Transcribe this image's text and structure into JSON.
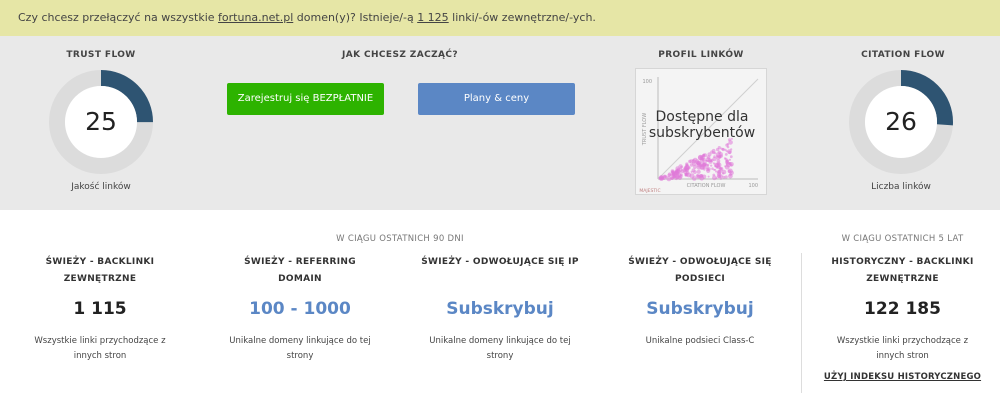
{
  "banner": {
    "text_before": "Czy chcesz przełączyć na wszystkie ",
    "domain_link": "fortuna.net.pl",
    "text_middle": " domen(y)? Istnieje/-ą ",
    "count_link": "1 125",
    "text_after": " linki/-ów zewnętrzne/-ych."
  },
  "trust_flow": {
    "title": "TRUST FLOW",
    "value": "25",
    "fraction": 0.25,
    "caption": "Jakość linków"
  },
  "start": {
    "title": "JAK CHCESZ ZACZĄĆ?",
    "register_label": "Zarejestruj się BEZPŁATNIE",
    "plans_label": "Plany & ceny"
  },
  "profile": {
    "title": "PROFIL LINKÓW",
    "overlay_line1": "Dostępne dla",
    "overlay_line2": "subskrybentów",
    "axis_x": "CITATION FLOW",
    "axis_y": "TRUST FLOW",
    "tick_max_x": "100",
    "tick_max_y": "100",
    "logo": "MAJESTIC"
  },
  "citation_flow": {
    "title": "CITATION FLOW",
    "value": "26",
    "fraction": 0.26,
    "caption": "Liczba linków"
  },
  "recent": {
    "label": "W CIĄGU OSTATNICH 90 DNI",
    "stats": [
      {
        "title_line1": "ŚWIEŻY - BACKLINKI",
        "title_line2": "ZEWNĘTRZNE",
        "value": "1 115",
        "desc_line1": "Wszystkie linki przychodzące z",
        "desc_line2": "innych stron"
      },
      {
        "title_line1": "ŚWIEŻY - REFERRING",
        "title_line2": "DOMAIN",
        "value": "100 - 1000",
        "desc_line1": "Unikalne domeny linkujące do tej",
        "desc_line2": "strony"
      },
      {
        "title_line1": "ŚWIEŻY - ODWOŁUJĄCE SIĘ IP",
        "title_line2": "",
        "value": "Subskrybuj",
        "desc_line1": "Unikalne domeny linkujące do tej",
        "desc_line2": "strony"
      },
      {
        "title_line1": "ŚWIEŻY - ODWOŁUJĄCE SIĘ",
        "title_line2": "PODSIECI",
        "value": "Subskrybuj",
        "desc_line1": "Unikalne podsieci Class-C",
        "desc_line2": ""
      }
    ]
  },
  "historic": {
    "label": "W CIĄGU OSTATNICH 5 LAT",
    "title_line1": "HISTORYCZNY - BACKLINKI",
    "title_line2": "ZEWNĘTRZNE",
    "value": "122 185",
    "desc_line1": "Wszystkie linki przychodzące z",
    "desc_line2": "innych stron",
    "link": "UŻYJ INDEKSU HISTORYCZNEGO"
  },
  "colors": {
    "banner_bg": "#e6e6a6",
    "gauge_track": "#dcdcdc",
    "gauge_fill": "#2e5472",
    "register_button": "#2db300",
    "plans_button": "#5b87c5",
    "subscribe_text": "#5b87c5",
    "scatter_points": "#e07ad8"
  }
}
